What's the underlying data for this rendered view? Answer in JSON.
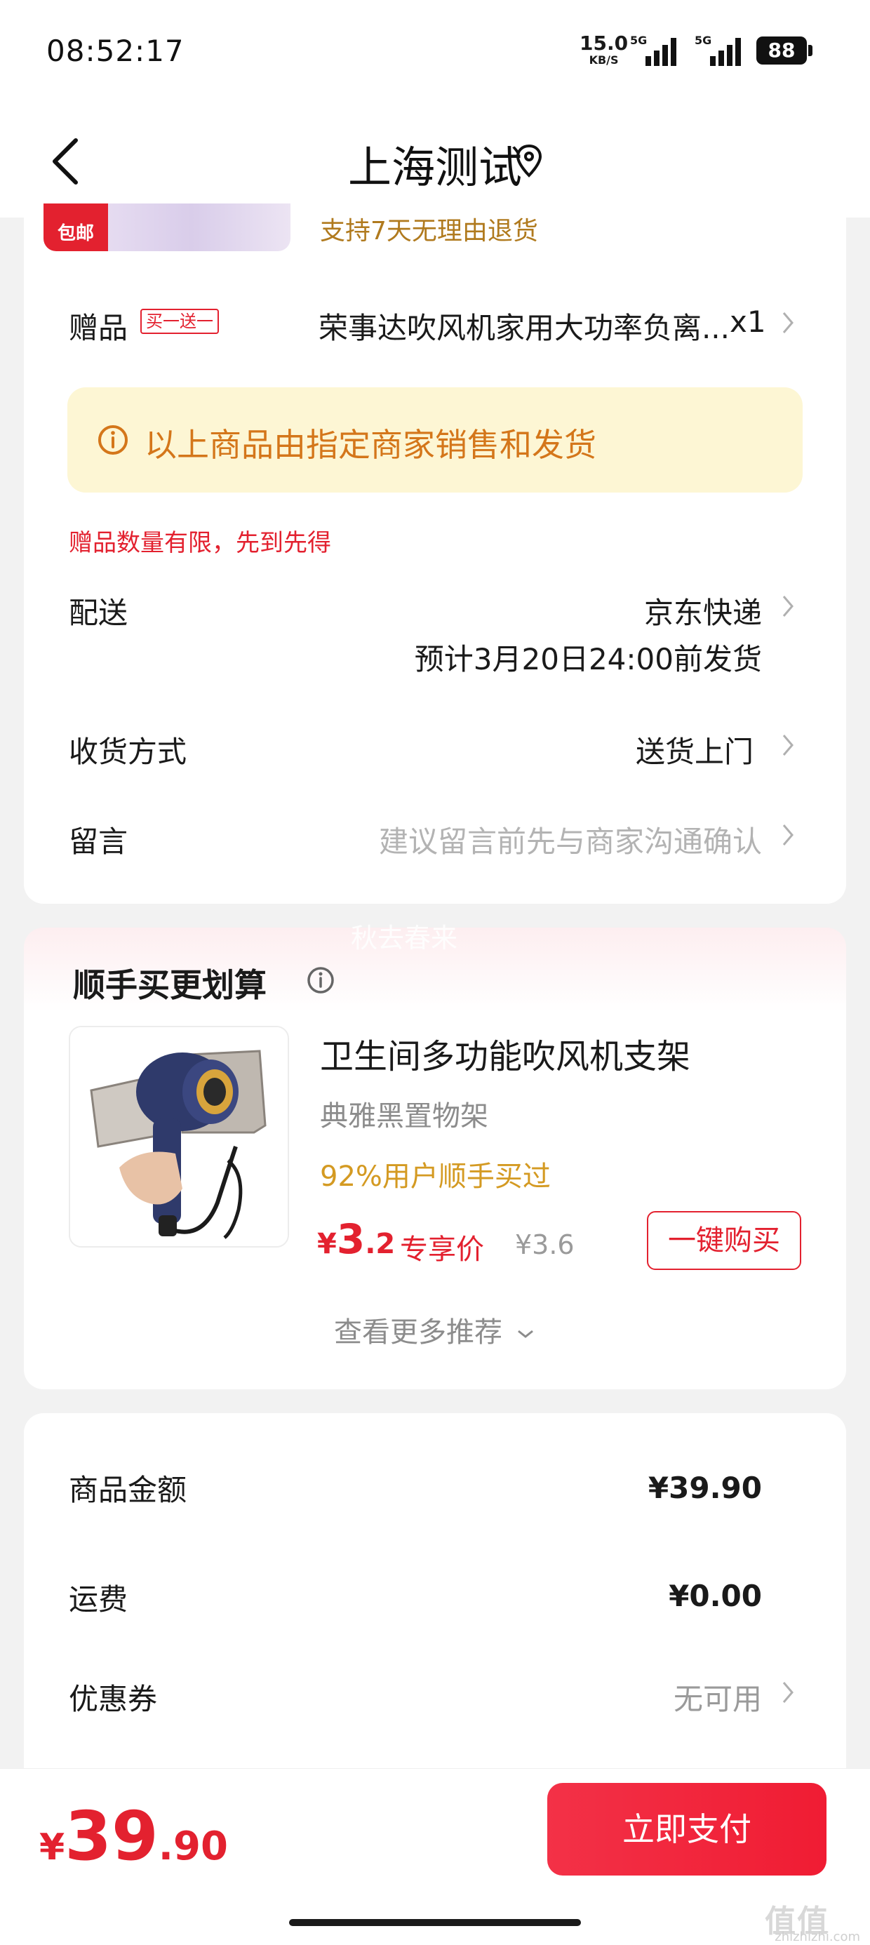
{
  "status_bar": {
    "time": "08:52:17",
    "net_speed": "15.0",
    "net_unit": "KB/S",
    "signal1_tag": "5G",
    "signal2_tag": "5G",
    "battery": "88"
  },
  "header": {
    "title": "上海测试"
  },
  "product": {
    "badge": "包邮",
    "return_policy": "支持7天无理由退货"
  },
  "gift": {
    "label": "赠品",
    "tag": "买一送一",
    "value": "荣事达吹风机家用大功率负离...",
    "qty": "x1"
  },
  "notice": {
    "text": "以上商品由指定商家销售和发货"
  },
  "limit_notice": "赠品数量有限，先到先得",
  "delivery": {
    "label": "配送",
    "value": "京东快递",
    "eta": "预计3月20日24:00前发货"
  },
  "receive": {
    "label": "收货方式",
    "value": "送货上门"
  },
  "message": {
    "label": "留言",
    "placeholder": "建议留言前先与商家沟通确认"
  },
  "recommend": {
    "watermark": "秋去春来",
    "title": "顺手买更划算",
    "item": {
      "name": "卫生间多功能吹风机支架",
      "sub": "典雅黑置物架",
      "stat": "92%用户顺手买过",
      "price_symbol": "¥",
      "price_int": "3",
      "price_dec": ".2",
      "price_label": "专享价",
      "orig_price": "¥3.6",
      "buy_label": "一键购买"
    },
    "more_label": "查看更多推荐"
  },
  "summary": {
    "goods_label": "商品金额",
    "goods_value": "¥39.90",
    "shipping_label": "运费",
    "shipping_value": "¥0.00",
    "coupon_label": "优惠券",
    "coupon_value": "无可用"
  },
  "footer": {
    "total_symbol": "¥",
    "total_int": "39",
    "total_dec": ".90",
    "pay_label": "立即支付"
  },
  "watermark_logo": {
    "glyphs": "值值值",
    "site": "zhizhizhi.com"
  },
  "colors": {
    "accent_red": "#e3212f",
    "notice_bg": "#fdf6d4",
    "notice_text": "#d4761a",
    "gold_text": "#b07a1e"
  }
}
